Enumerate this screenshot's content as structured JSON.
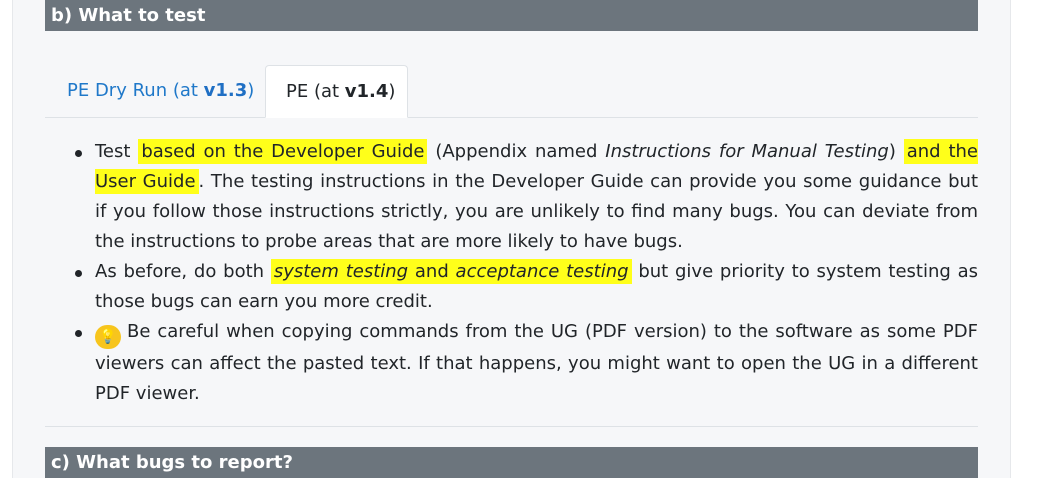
{
  "sections": {
    "b_title": "b) What to test",
    "c_title": "c) What bugs to report?"
  },
  "tabs": [
    {
      "label": "PE Dry Run (at ",
      "version": "v1.3",
      "suffix": ")",
      "active": false
    },
    {
      "label": "PE (at ",
      "version": "v1.4",
      "suffix": ")",
      "active": true
    }
  ],
  "content": {
    "item1": {
      "t1": "Test ",
      "h1": "based on the Developer Guide",
      "t2": " (Appendix named ",
      "em1": "Instructions for Manual Testing",
      "t3": ") ",
      "h2": "and the User Guide",
      "t4": ". The testing instructions in the Developer Guide can provide you some guidance but if you follow those instructions strictly, you are unlikely to find many bugs. You can deviate from the instructions to probe areas that are more likely to have bugs."
    },
    "item2": {
      "t1": "As before, do both ",
      "em1": "system testing",
      "and": " and ",
      "em2": "acceptance testing",
      "t2": " but give priority to system testing as those bugs can earn you more credit."
    },
    "item3": {
      "icon": "lightbulb-icon",
      "t1": "Be careful when copying commands from the UG (PDF version) to the software as some PDF viewers can affect the pasted text. If that happens, you might want to open the UG in a different PDF viewer."
    }
  },
  "colors": {
    "header_bg": "#6c757d",
    "highlight": "#ffff1a",
    "link": "#1f78c9",
    "tip_icon": "#f7c51d"
  }
}
